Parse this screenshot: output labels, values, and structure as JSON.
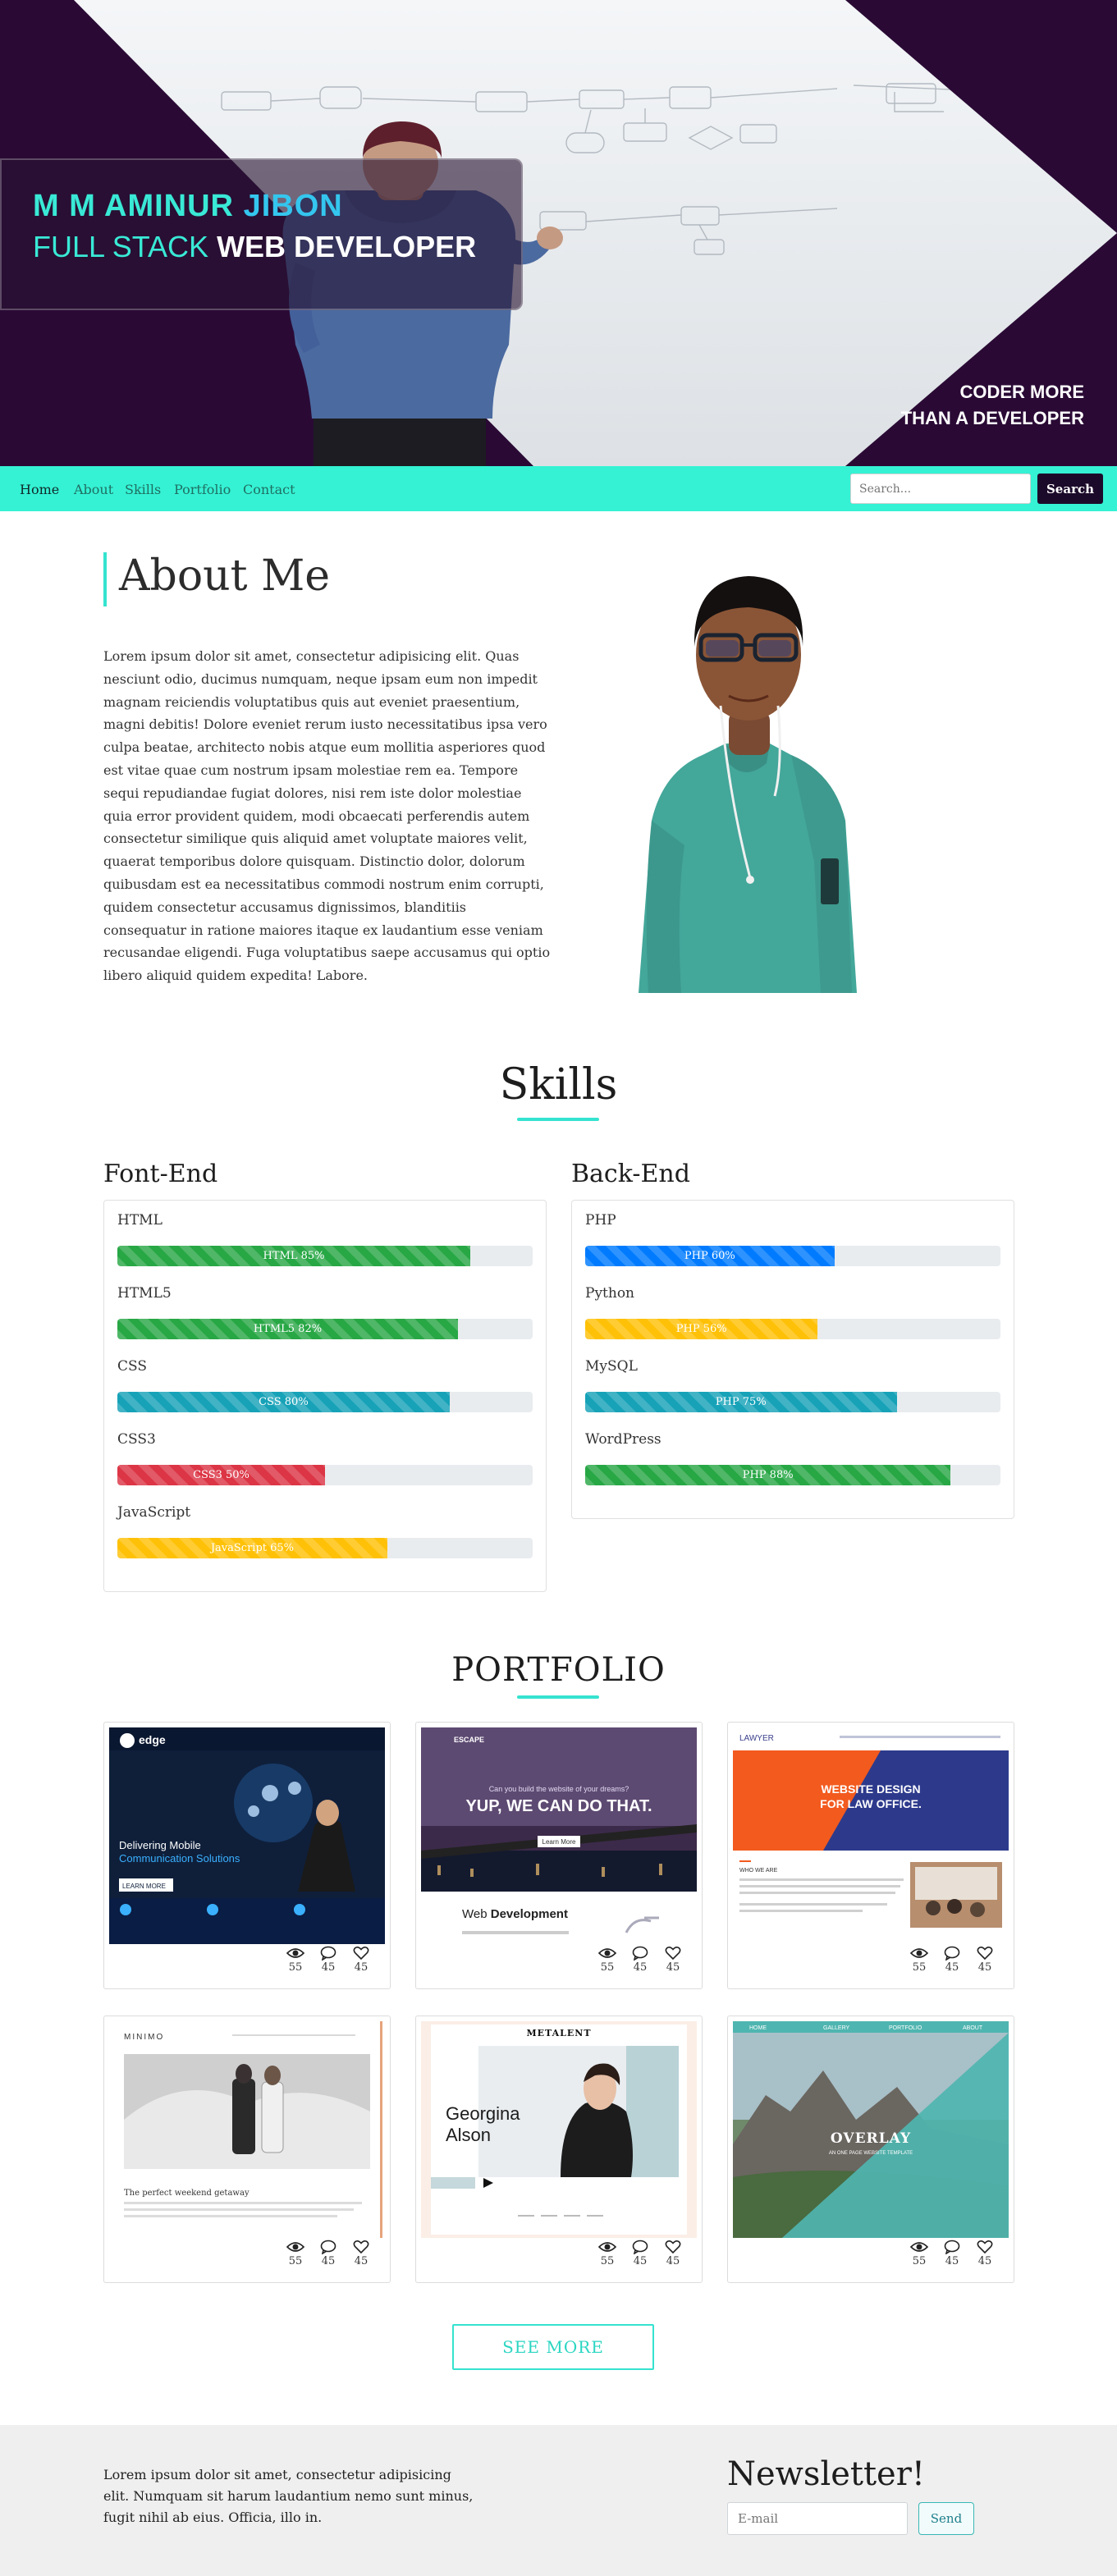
{
  "hero": {
    "name_part1": "M M AMINUR ",
    "name_part2": "JIBON",
    "role_part1": "FULL STACK ",
    "role_part2": "WEB DEVELOPER",
    "tagline_line1": "CODER MORE",
    "tagline_line2": "THAN A DEVELOPER",
    "colors": {
      "dark": "#2a0a35",
      "accent": "#39e9d6"
    }
  },
  "nav": {
    "links": [
      "Home",
      "About",
      "Skills",
      "Portfolio",
      "Contact"
    ],
    "active": "Home",
    "search_placeholder": "Search...",
    "search_button": "Search"
  },
  "about": {
    "title": "About Me",
    "text": "Lorem ipsum dolor sit amet, consectetur adipisicing elit. Quas nesciunt odio, ducimus numquam, neque ipsam eum non impedit magnam reiciendis voluptatibus quis aut eveniet praesentium, magni debitis! Dolore eveniet rerum iusto necessitatibus ipsa vero culpa beatae, architecto nobis atque eum mollitia asperiores quod est vitae quae cum nostrum ipsam molestiae rem ea. Tempore sequi repudiandae fugiat dolores, nisi rem iste dolor molestiae quia error provident quidem, modi obcaecati perferendis autem consectetur similique quis aliquid amet voluptate maiores velit, quaerat temporibus dolore quisquam. Distinctio dolor, dolorum quibusdam est ea necessitatibus commodi nostrum enim corrupti, quidem consectetur accusamus dignissimos, blanditiis consequatur in ratione maiores itaque ex laudantium esse veniam recusandae eligendi. Fuga voluptatibus saepe accusamus qui optio libero aliquid quidem expedita! Labore."
  },
  "skills": {
    "title": "Skills",
    "frontend": {
      "title": "Font-End",
      "items": [
        {
          "name": "HTML",
          "label": "HTML 85%",
          "percent": 85,
          "color": "#28a745"
        },
        {
          "name": "HTML5",
          "label": "HTML5 82%",
          "percent": 82,
          "color": "#28a745"
        },
        {
          "name": "CSS",
          "label": "CSS 80%",
          "percent": 80,
          "color": "#17a2b8"
        },
        {
          "name": "CSS3",
          "label": "CSS3 50%",
          "percent": 50,
          "color": "#dc3545"
        },
        {
          "name": "JavaScript",
          "label": "JavaScript 65%",
          "percent": 65,
          "color": "#ffc107"
        }
      ]
    },
    "backend": {
      "title": "Back-End",
      "items": [
        {
          "name": "PHP",
          "label": "PHP 60%",
          "percent": 60,
          "color": "#007bff"
        },
        {
          "name": "Python",
          "label": "PHP 56%",
          "percent": 56,
          "color": "#ffc107"
        },
        {
          "name": "MySQL",
          "label": "PHP 75%",
          "percent": 75,
          "color": "#17a2b8"
        },
        {
          "name": "WordPress",
          "label": "PHP 88%",
          "percent": 88,
          "color": "#28a745"
        }
      ]
    }
  },
  "portfolio": {
    "title": "PORTFOLIO",
    "cards": [
      {
        "views": "55",
        "comments": "45",
        "likes": "45",
        "thumb": {
          "logo": "edge",
          "headline": "Delivering Mobile",
          "subline": "Communication Solutions",
          "btn": "LEARN MORE"
        }
      },
      {
        "views": "55",
        "comments": "45",
        "likes": "45",
        "thumb": {
          "logo": "ESCAPE",
          "question": "Can you build the website of your dreams?",
          "headline": "YUP, WE CAN DO THAT.",
          "btn": "Learn More",
          "heading_a": "Web ",
          "heading_b": "Development"
        }
      },
      {
        "views": "55",
        "comments": "45",
        "likes": "45",
        "thumb": {
          "logo": "LAWYER",
          "headline1": "WEBSITE DESIGN",
          "headline2": "FOR LAW OFFICE.",
          "small": "WHO WE ARE"
        }
      },
      {
        "views": "55",
        "comments": "45",
        "likes": "45",
        "thumb": {
          "logo": "MINIMO",
          "caption": "The perfect weekend getaway"
        }
      },
      {
        "views": "55",
        "comments": "45",
        "likes": "45",
        "thumb": {
          "logo": "METALENT",
          "name1": "Georgina",
          "name2": "Alson"
        }
      },
      {
        "views": "55",
        "comments": "45",
        "likes": "45",
        "thumb": {
          "menu": [
            "HOME",
            "GALLERY",
            "PORTFOLIO",
            "ABOUT"
          ],
          "headline": "OVERLAY",
          "subline": "AN ONE PAGE WEBSITE TEMPLATE"
        }
      }
    ],
    "see_more": "SEE MORE"
  },
  "footer": {
    "text": "Lorem ipsum dolor sit amet, consectetur adipisicing elit. Numquam sit harum laudantium nemo sunt minus, fugit nihil ab eius. Officia, illo in.",
    "newsletter_title": "Newsletter!",
    "email_placeholder": "E-mail",
    "send_button": "Send"
  }
}
